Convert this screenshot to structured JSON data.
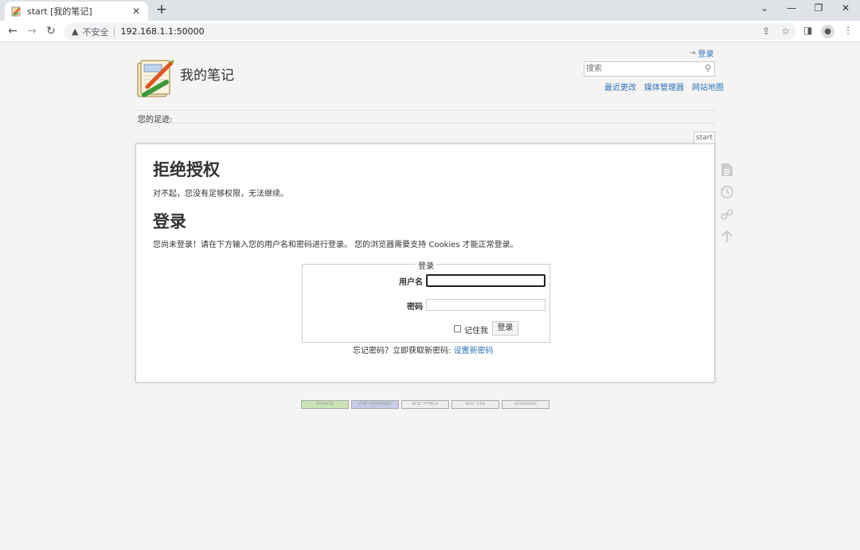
{
  "browser": {
    "tab_title": "start [我的笔记]",
    "insecure_label": "不安全",
    "url": "192.168.1.1:50000"
  },
  "header": {
    "login_link": "登录",
    "site_title": "我的笔记",
    "search_placeholder": "搜索",
    "site_tools": [
      "最近更改",
      "媒体管理器",
      "网站地图"
    ]
  },
  "breadcrumb": {
    "label": "您的足迹:"
  },
  "page_tab": "start",
  "content": {
    "denied_heading": "拒绝授权",
    "denied_text": "对不起，您没有足够权限，无法继续。",
    "login_heading": "登录",
    "login_text": "您尚未登录！请在下方输入您的用户名和密码进行登录。 您的浏览器需要支持 Cookies 才能正常登录。",
    "form": {
      "legend": "登录",
      "username_label": "用户名",
      "username_value": "",
      "password_label": "密码",
      "password_value": "",
      "remember_label": "记住我",
      "remember_checked": false,
      "submit_label": "登录"
    },
    "forgot_prefix": "忘记密码？立即获取新密码: ",
    "forgot_link": "设置新密码"
  },
  "footer_badges": [
    "DONATE",
    "PHP POWERED",
    "W3C HTML5",
    "W3C CSS",
    "DOKUWIKI"
  ]
}
